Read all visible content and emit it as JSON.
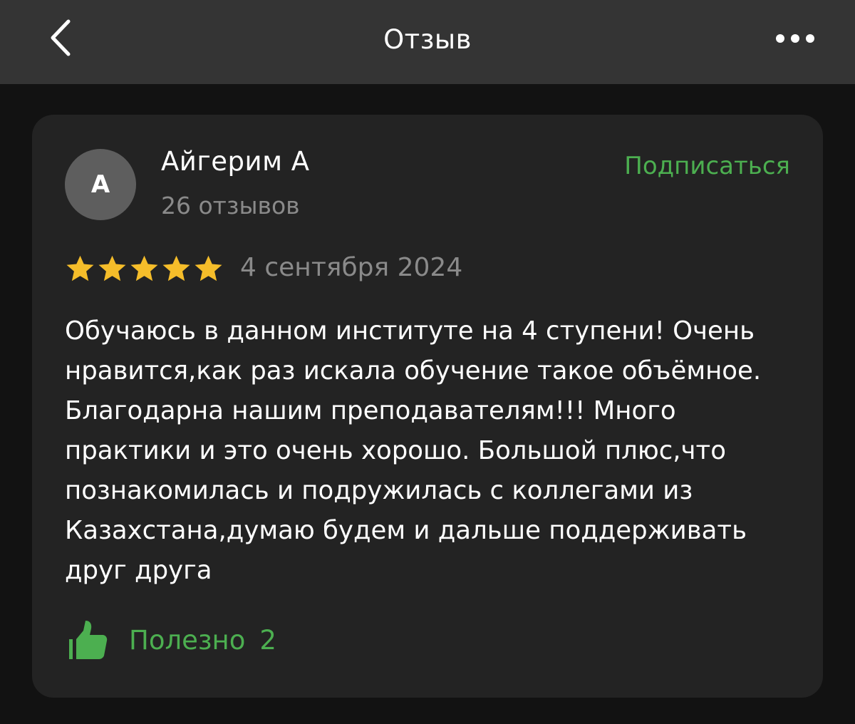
{
  "header": {
    "title": "Отзыв",
    "back_icon": "chevron-left-icon",
    "more_icon": "more-horizontal-icon"
  },
  "review": {
    "author": {
      "initial": "А",
      "name": "Айгерим А",
      "reviews_count_text": "26 отзывов"
    },
    "subscribe_label": "Подписаться",
    "rating": 5,
    "rating_max": 5,
    "date": "4 сентября 2024",
    "text": "Обучаюсь в данном институте на 4 ступени! Очень нравится,как раз искала обучение такое объёмное. Благодарна нашим преподавателям!!! Много практики и это очень хорошо. Большой плюс,что познакомилась и подружилась с коллегами из Казахстана,думаю будем и дальше поддерживать друг друга",
    "helpful_label": "Полезно",
    "helpful_count": "2"
  },
  "colors": {
    "background": "#121212",
    "topbar": "#343434",
    "card": "#232323",
    "accent_green": "#4caf50",
    "star": "#f5bd2a",
    "muted_text": "#8a8a8a"
  }
}
